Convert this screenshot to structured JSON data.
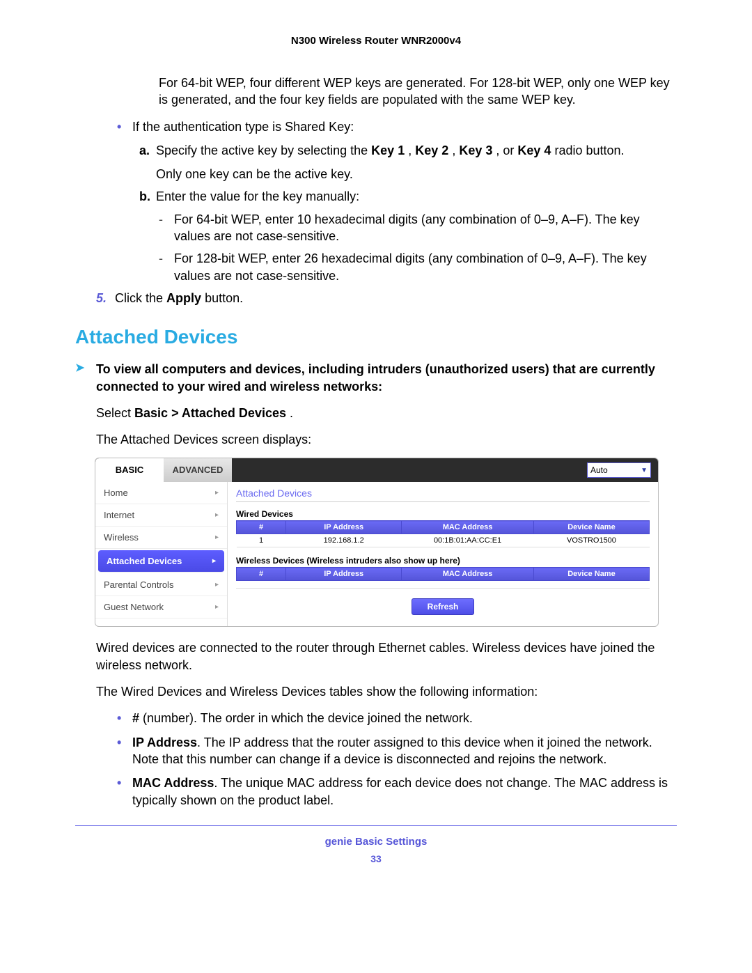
{
  "header": "N300 Wireless Router WNR2000v4",
  "intro_para": "For 64-bit WEP, four different WEP keys are generated. For 128-bit WEP, only one WEP key is generated, and the four key fields are populated with the same WEP key.",
  "shared_key_line": "If the authentication type is Shared Key:",
  "sub_a_prefix": "Specify the active key by selecting the ",
  "sub_a_bold1": "Key 1",
  "sub_a_sep": ", ",
  "sub_a_bold2": "Key 2",
  "sub_a_bold3": "Key 3",
  "sub_a_or": ", or ",
  "sub_a_bold4": "Key 4",
  "sub_a_suffix": " radio button.",
  "sub_a_note": "Only one key can be the active key.",
  "sub_b": "Enter the value for the key manually:",
  "dash1": "For 64-bit WEP, enter 10 hexadecimal digits (any combination of 0–9, A–F). The key values are not case-sensitive.",
  "dash2": "For 128-bit WEP, enter 26 hexadecimal digits (any combination of 0–9, A–F). The key values are not case-sensitive.",
  "step5_prefix": "Click the ",
  "step5_bold": "Apply",
  "step5_suffix": " button.",
  "section_title": "Attached Devices",
  "arrow_text": "To view all computers and devices, including intruders (unauthorized users) that are currently connected to your wired and wireless networks:",
  "select_prefix": "Select ",
  "select_bold": "Basic > Attached Devices",
  "select_suffix": ".",
  "screen_caption": "The Attached Devices screen displays:",
  "tabs": {
    "basic": "BASIC",
    "advanced": "ADVANCED"
  },
  "dropdown_value": "Auto",
  "sidebar_items": [
    {
      "label": "Home",
      "active": false
    },
    {
      "label": "Internet",
      "active": false
    },
    {
      "label": "Wireless",
      "active": false
    },
    {
      "label": "Attached Devices",
      "active": true
    },
    {
      "label": "Parental Controls",
      "active": false
    },
    {
      "label": "Guest Network",
      "active": false
    }
  ],
  "panel_title": "Attached Devices",
  "wired_caption": "Wired Devices",
  "wireless_caption": "Wireless Devices (Wireless intruders also show up here)",
  "cols": {
    "num": "#",
    "ip": "IP Address",
    "mac": "MAC Address",
    "name": "Device Name"
  },
  "wired_rows": [
    {
      "num": "1",
      "ip": "192.168.1.2",
      "mac": "00:1B:01:AA:CC:E1",
      "name": "VOSTRO1500"
    }
  ],
  "refresh_label": "Refresh",
  "after1": "Wired devices are connected to the router through Ethernet cables. Wireless devices have joined the wireless network.",
  "after2": "The Wired Devices and Wireless Devices tables show the following information:",
  "b_num_bold": "#",
  "b_num_text": " (number). The order in which the device joined the network.",
  "b_ip_bold": "IP Address",
  "b_ip_text": ". The IP address that the router assigned to this device when it joined the network. Note that this number can change if a device is disconnected and rejoins the network.",
  "b_mac_bold": "MAC Address",
  "b_mac_text": ". The unique MAC address for each device does not change. The MAC address is typically shown on the product label.",
  "footer_title": "genie Basic Settings",
  "footer_page": "33"
}
